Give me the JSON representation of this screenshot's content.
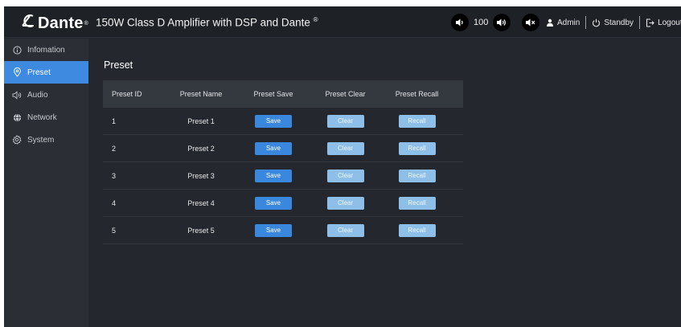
{
  "brand": {
    "logo": "Dante",
    "trademark": "®"
  },
  "header": {
    "title": "150W Class D Amplifier with DSP and Dante",
    "title_mark": "®",
    "volume_value": "100",
    "user": "Admin",
    "standby": "Standby",
    "logout": "Logout"
  },
  "sidebar": {
    "items": [
      {
        "label": "Infomation",
        "icon": "info-icon",
        "active": false
      },
      {
        "label": "Preset",
        "icon": "location-pin-icon",
        "active": true
      },
      {
        "label": "Audio",
        "icon": "speaker-icon",
        "active": false
      },
      {
        "label": "Network",
        "icon": "globe-icon",
        "active": false
      },
      {
        "label": "System",
        "icon": "gear-icon",
        "active": false
      }
    ]
  },
  "main": {
    "page_title": "Preset",
    "columns": [
      "Preset ID",
      "Preset Name",
      "Preset Save",
      "Preset Clear",
      "Preset Recall"
    ],
    "rows": [
      {
        "id": "1",
        "name": "Preset 1",
        "save": "Save",
        "clear": "Clear",
        "recall": "Recall"
      },
      {
        "id": "2",
        "name": "Preset 2",
        "save": "Save",
        "clear": "Clear",
        "recall": "Recall"
      },
      {
        "id": "3",
        "name": "Preset 3",
        "save": "Save",
        "clear": "Clear",
        "recall": "Recall"
      },
      {
        "id": "4",
        "name": "Preset 4",
        "save": "Save",
        "clear": "Clear",
        "recall": "Recall"
      },
      {
        "id": "5",
        "name": "Preset 5",
        "save": "Save",
        "clear": "Clear",
        "recall": "Recall"
      }
    ]
  },
  "colors": {
    "accent": "#3d8ae0",
    "save_button": "#3988dd",
    "disabled_button": "#8ebfe8",
    "background": "#24282e",
    "sidebar": "#2b2f35",
    "topbar": "#1e2227"
  }
}
